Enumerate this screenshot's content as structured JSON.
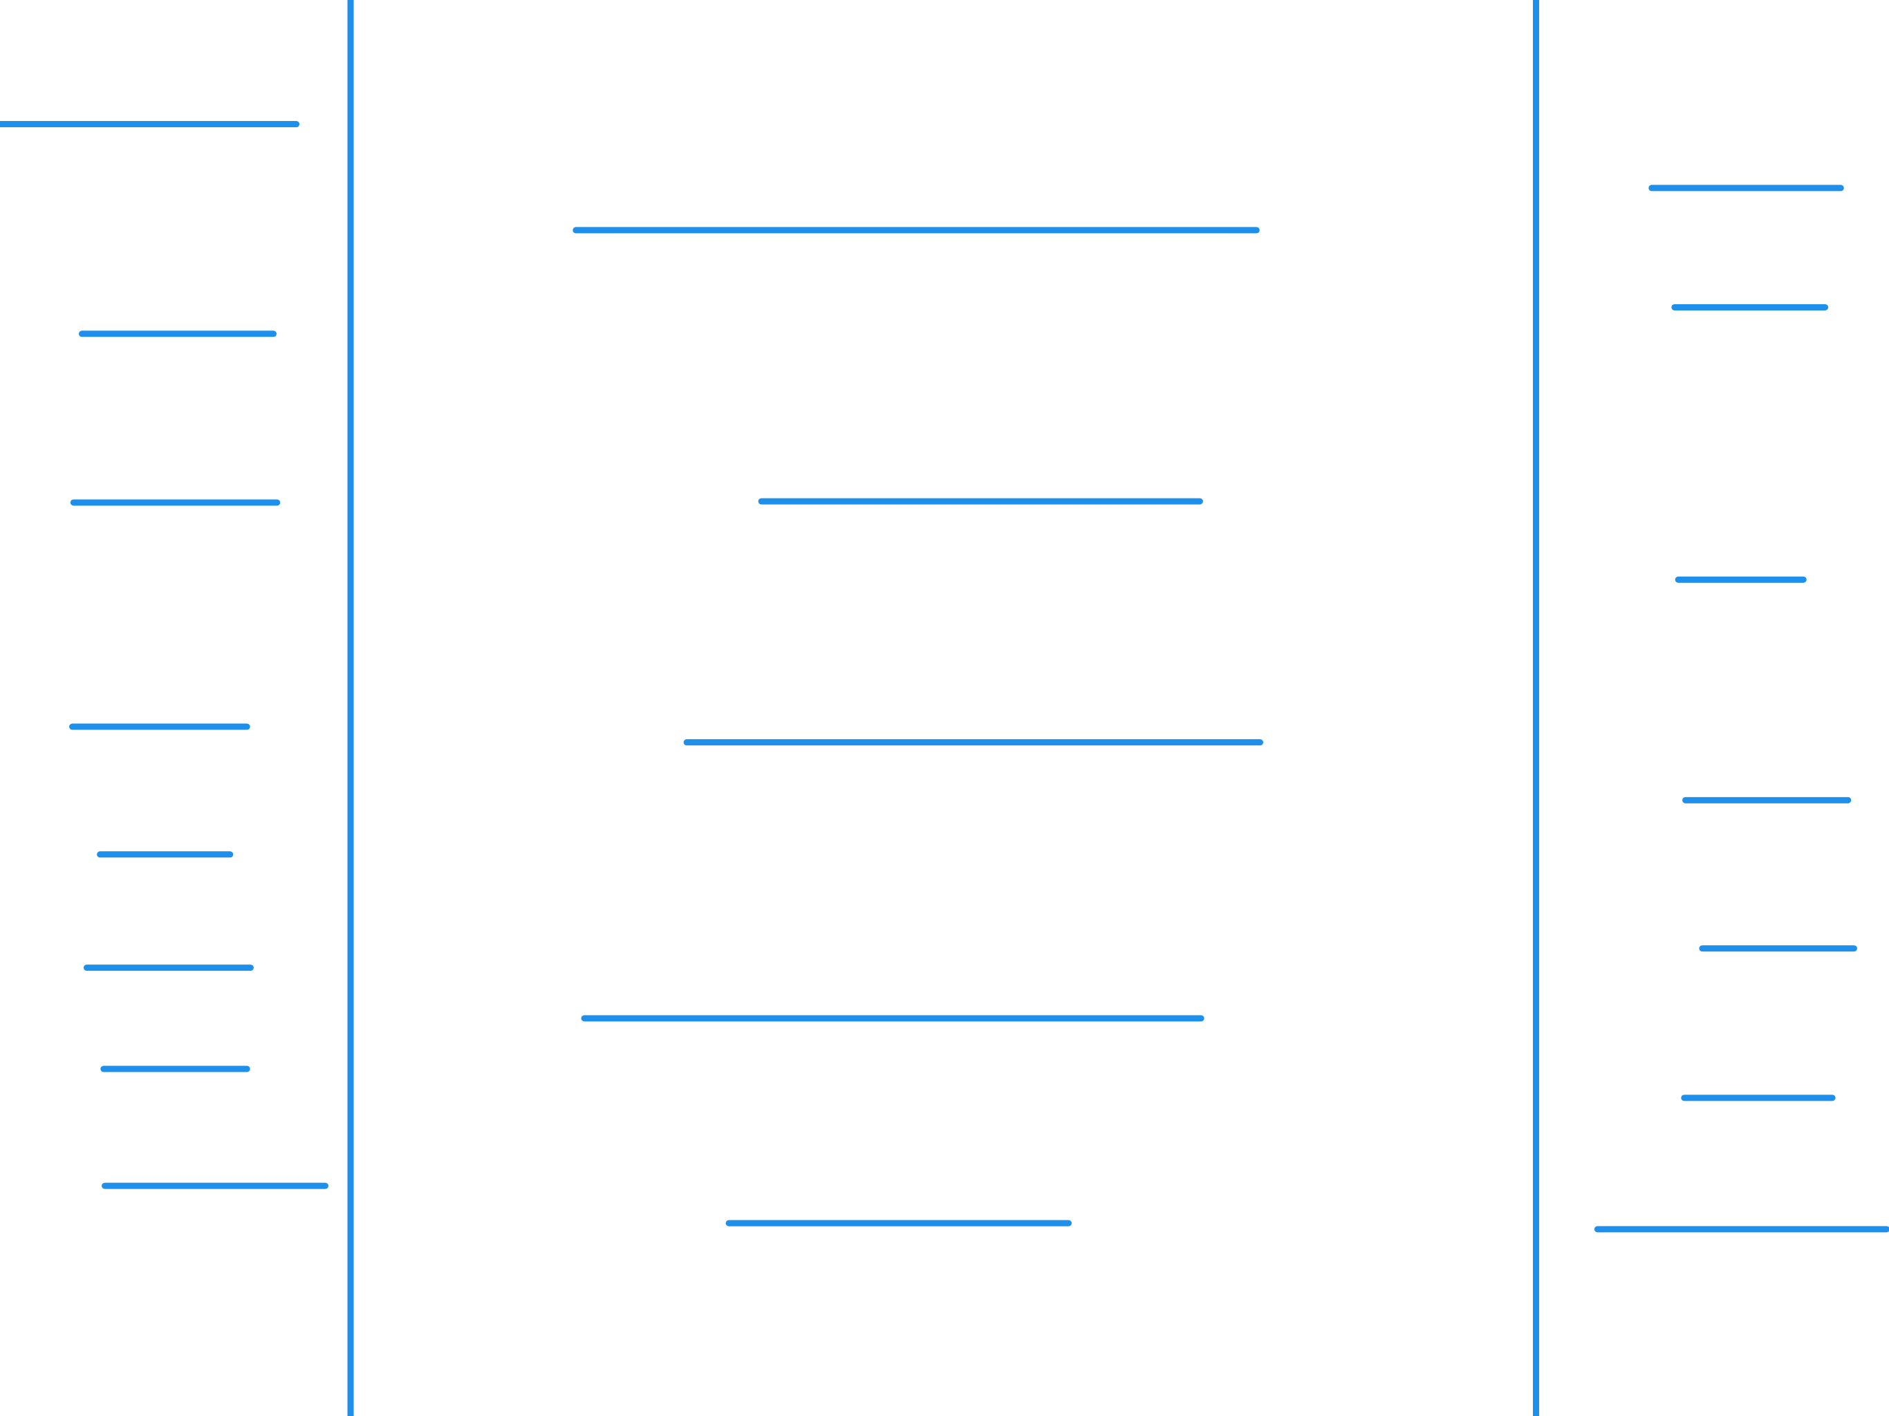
{
  "stroke_color": "#1E8FEA",
  "background_color": "#FFFFFF",
  "column_dividers": [
    {
      "name": "left-divider"
    },
    {
      "name": "right-divider"
    }
  ],
  "left_column_lines": [
    {
      "name": "left-line-1"
    },
    {
      "name": "left-line-2"
    },
    {
      "name": "left-line-3"
    },
    {
      "name": "left-line-4"
    },
    {
      "name": "left-line-5"
    },
    {
      "name": "left-line-6"
    },
    {
      "name": "left-line-7"
    },
    {
      "name": "left-line-8"
    }
  ],
  "center_column_lines": [
    {
      "name": "center-line-1"
    },
    {
      "name": "center-line-2"
    },
    {
      "name": "center-line-3"
    },
    {
      "name": "center-line-4"
    },
    {
      "name": "center-line-5"
    }
  ],
  "right_column_lines": [
    {
      "name": "right-line-1"
    },
    {
      "name": "right-line-2"
    },
    {
      "name": "right-line-3"
    },
    {
      "name": "right-line-4"
    },
    {
      "name": "right-line-5"
    },
    {
      "name": "right-line-6"
    },
    {
      "name": "right-line-7"
    }
  ]
}
